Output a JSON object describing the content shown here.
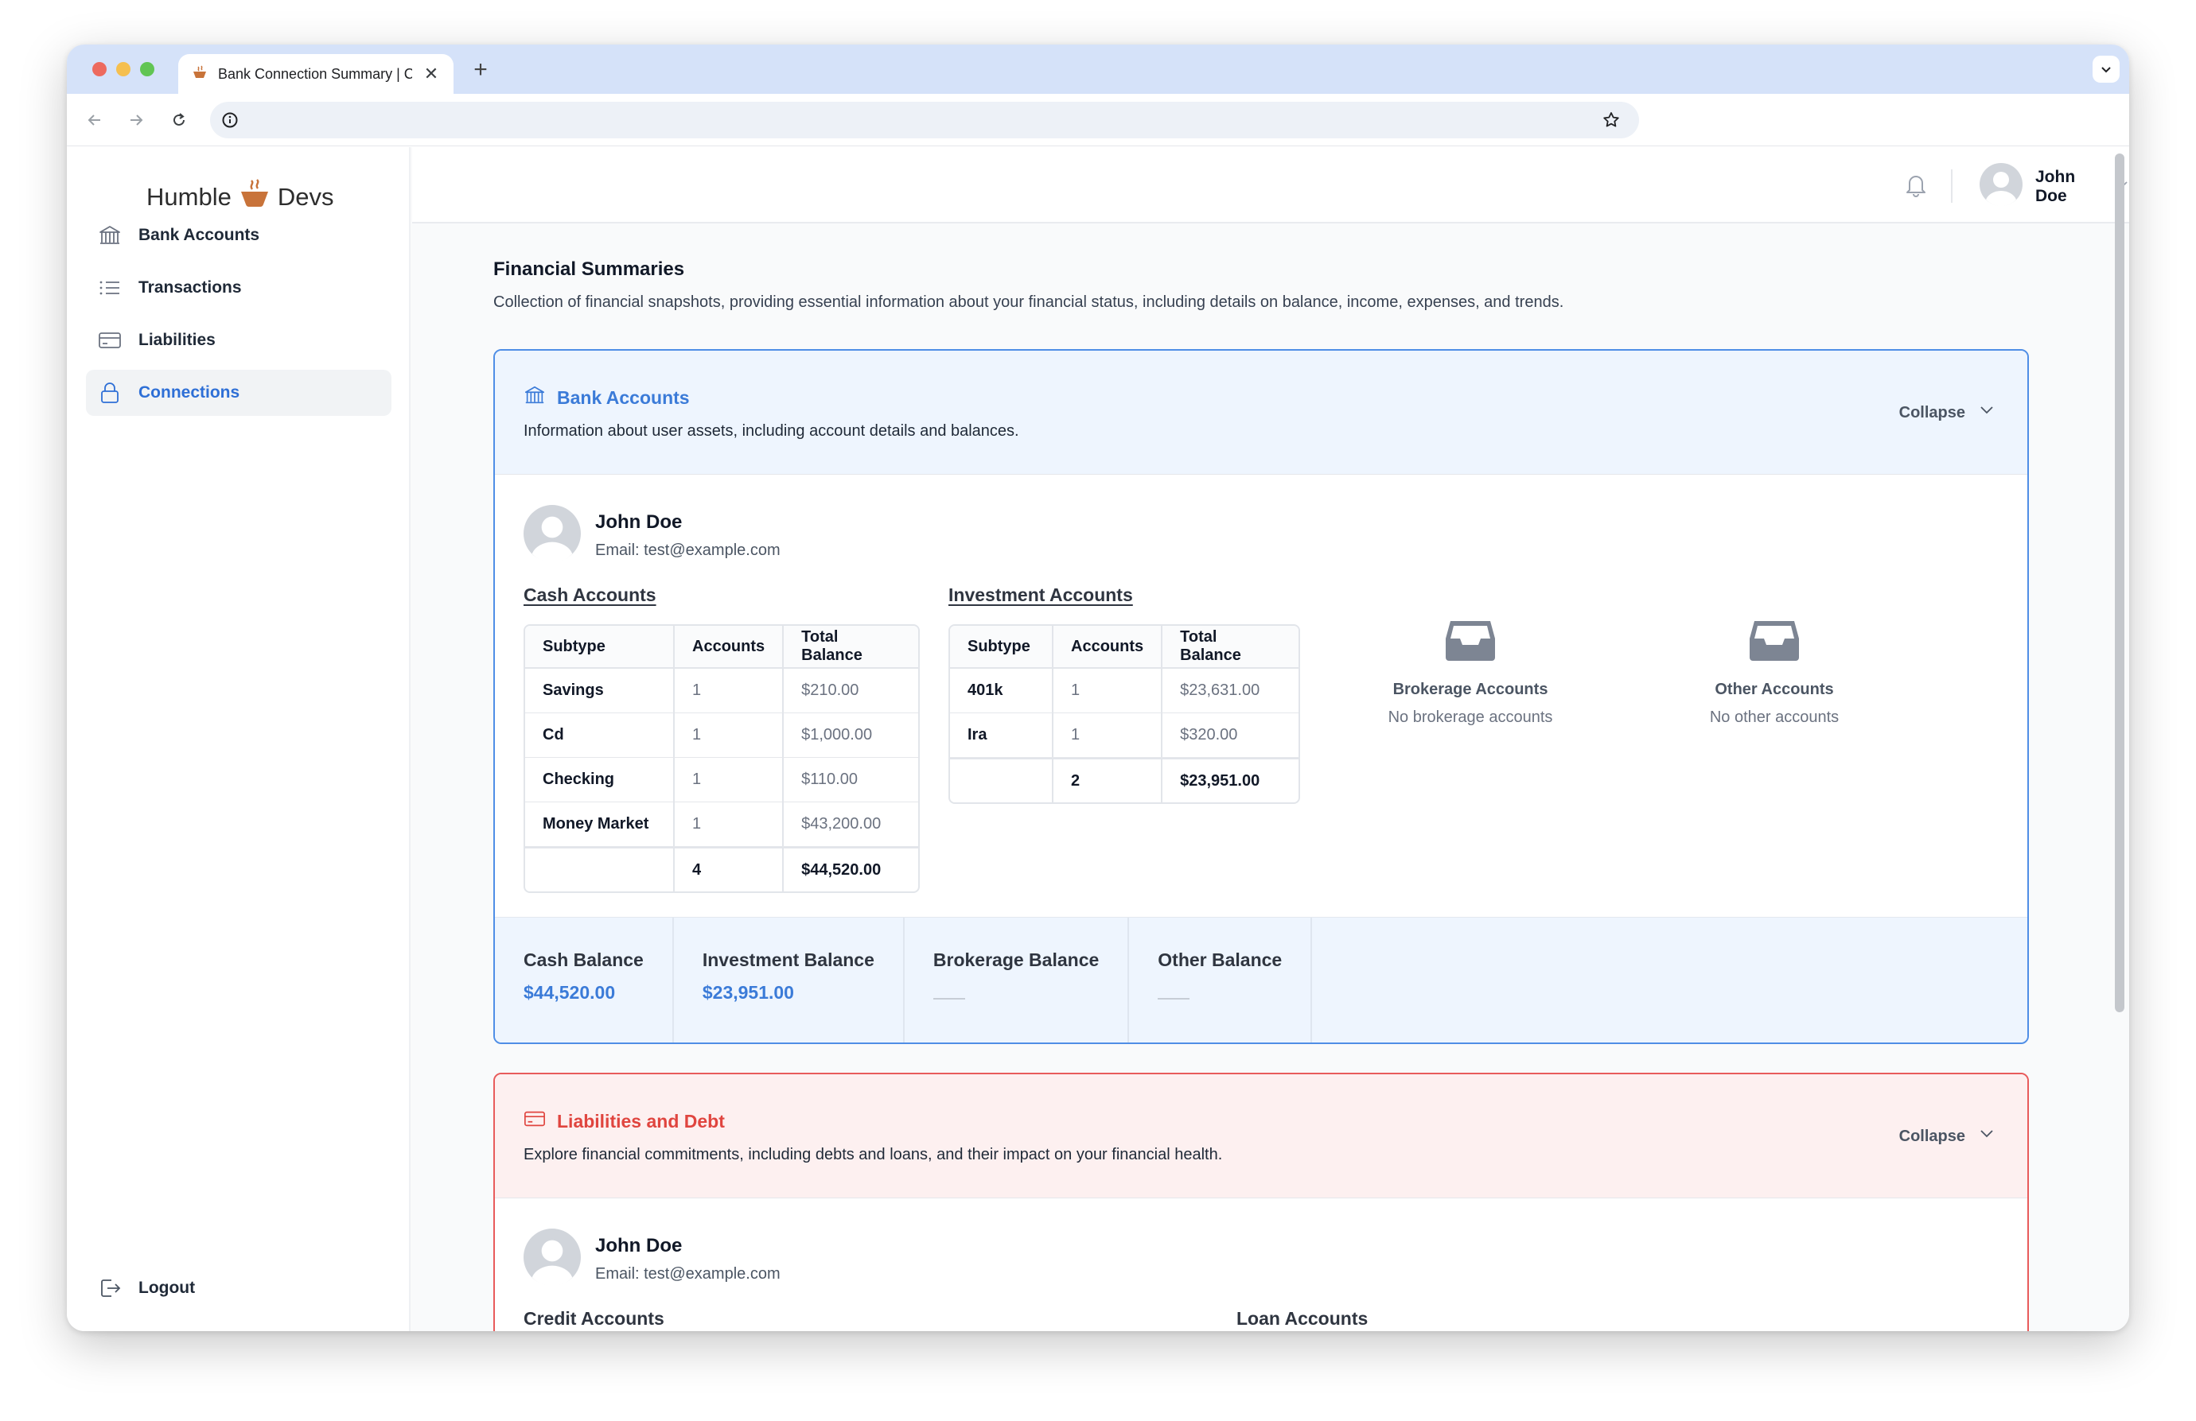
{
  "browser": {
    "tab_title": "Bank Connection Summary | C",
    "new_tab_symbol": "+",
    "close_symbol": "✕",
    "traffic_colors": [
      "#ed6a5e",
      "#f5bf4f",
      "#61c554"
    ]
  },
  "brand": {
    "name_left": "Humble",
    "name_right": "Devs",
    "accent": "#c8733a"
  },
  "sidebar": {
    "items": [
      {
        "label": "Bank Accounts",
        "icon": "bank-icon"
      },
      {
        "label": "Transactions",
        "icon": "list-icon"
      },
      {
        "label": "Liabilities",
        "icon": "credit-card-icon"
      },
      {
        "label": "Connections",
        "icon": "lock-icon",
        "active": true
      }
    ],
    "logout_label": "Logout"
  },
  "header": {
    "user_name": "John Doe"
  },
  "page": {
    "title": "Financial Summaries",
    "description": "Collection of financial snapshots, providing essential information about your financial status, including details on balance, income, expenses, and trends."
  },
  "bank_card": {
    "title": "Bank Accounts",
    "description": "Information about user assets, including account details and balances.",
    "collapse_label": "Collapse",
    "user": {
      "name": "John Doe",
      "email": "Email: test@example.com"
    },
    "cash": {
      "title": "Cash Accounts",
      "headers": [
        "Subtype",
        "Accounts",
        "Total Balance"
      ],
      "rows": [
        {
          "subtype": "Savings",
          "accounts": "1",
          "balance": "$210.00"
        },
        {
          "subtype": "Cd",
          "accounts": "1",
          "balance": "$1,000.00"
        },
        {
          "subtype": "Checking",
          "accounts": "1",
          "balance": "$110.00"
        },
        {
          "subtype": "Money Market",
          "accounts": "1",
          "balance": "$43,200.00"
        }
      ],
      "total_accounts": "4",
      "total_balance": "$44,520.00"
    },
    "investment": {
      "title": "Investment Accounts",
      "headers": [
        "Subtype",
        "Accounts",
        "Total Balance"
      ],
      "rows": [
        {
          "subtype": "401k",
          "accounts": "1",
          "balance": "$23,631.00"
        },
        {
          "subtype": "Ira",
          "accounts": "1",
          "balance": "$320.00"
        }
      ],
      "total_accounts": "2",
      "total_balance": "$23,951.00"
    },
    "brokerage": {
      "title": "Brokerage Accounts",
      "empty": "No brokerage accounts"
    },
    "other": {
      "title": "Other Accounts",
      "empty": "No other accounts"
    },
    "balances": [
      {
        "label": "Cash Balance",
        "value": "$44,520.00"
      },
      {
        "label": "Investment Balance",
        "value": "$23,951.00"
      },
      {
        "label": "Brokerage Balance",
        "value": null
      },
      {
        "label": "Other Balance",
        "value": null
      }
    ]
  },
  "liabilities_card": {
    "title": "Liabilities and Debt",
    "description": "Explore financial commitments, including debts and loans, and their impact on your financial health.",
    "collapse_label": "Collapse",
    "user": {
      "name": "John Doe",
      "email": "Email: test@example.com"
    },
    "credit_title": "Credit Accounts",
    "loan_title": "Loan Accounts"
  },
  "colors": {
    "primary": "#3b7bd8",
    "danger": "#e0453f"
  }
}
